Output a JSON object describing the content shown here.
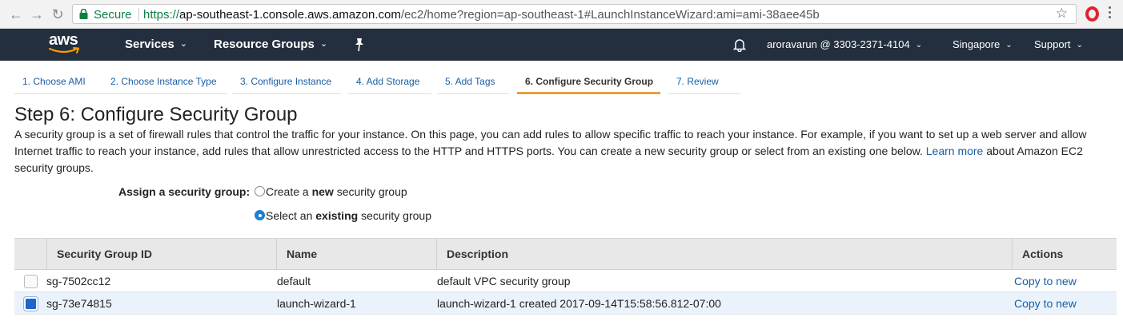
{
  "browser": {
    "secure_label": "Secure",
    "url_scheme": "https://",
    "url_host": "ap-southeast-1.console.aws.amazon.com",
    "url_path": "/ec2/home?region=ap-southeast-1#LaunchInstanceWizard:ami=ami-38aee45b"
  },
  "header": {
    "logo": "aws",
    "services": "Services",
    "resource_groups": "Resource Groups",
    "account": "aroravarun @ 3303-2371-4104",
    "region": "Singapore",
    "support": "Support"
  },
  "wizard_tabs": [
    {
      "label": "1. Choose AMI"
    },
    {
      "label": "2. Choose Instance Type"
    },
    {
      "label": "3. Configure Instance"
    },
    {
      "label": "4. Add Storage"
    },
    {
      "label": "5. Add Tags"
    },
    {
      "label": "6. Configure Security Group"
    },
    {
      "label": "7. Review"
    }
  ],
  "active_tab": "6. Configure Security Group",
  "page": {
    "title": "Step 6: Configure Security Group",
    "description_part1": "A security group is a set of firewall rules that control the traffic for your instance. On this page, you can add rules to allow specific traffic to reach your instance. For example, if you want to set up a web server and allow Internet traffic to reach your instance, add rules that allow unrestricted access to the HTTP and HTTPS ports. You can create a new security group or select from an existing one below.",
    "learn_more": "Learn more",
    "description_part2": "about Amazon EC2 security groups."
  },
  "assign": {
    "label": "Assign a security group:",
    "option_new_pre": "Create a ",
    "option_new_bold": "new",
    "option_new_post": " security group",
    "option_existing_pre": "Select an ",
    "option_existing_bold": "existing",
    "option_existing_post": " security group",
    "selected": "existing"
  },
  "table": {
    "headers": {
      "id": "Security Group ID",
      "name": "Name",
      "description": "Description",
      "actions": "Actions"
    },
    "rows": [
      {
        "id": "sg-7502cc12",
        "name": "default",
        "description": "default VPC security group",
        "action": "Copy to new",
        "checked": false
      },
      {
        "id": "sg-73e74815",
        "name": "launch-wizard-1",
        "description": "launch-wizard-1 created 2017-09-14T15:58:56.812-07:00",
        "action": "Copy to new",
        "checked": true
      }
    ]
  },
  "colors": {
    "aws_header_bg": "#232f3e",
    "link": "#1a5ea3",
    "active_tab_underline": "#e8a03e",
    "selected_row_bg": "#eaf3fc"
  }
}
